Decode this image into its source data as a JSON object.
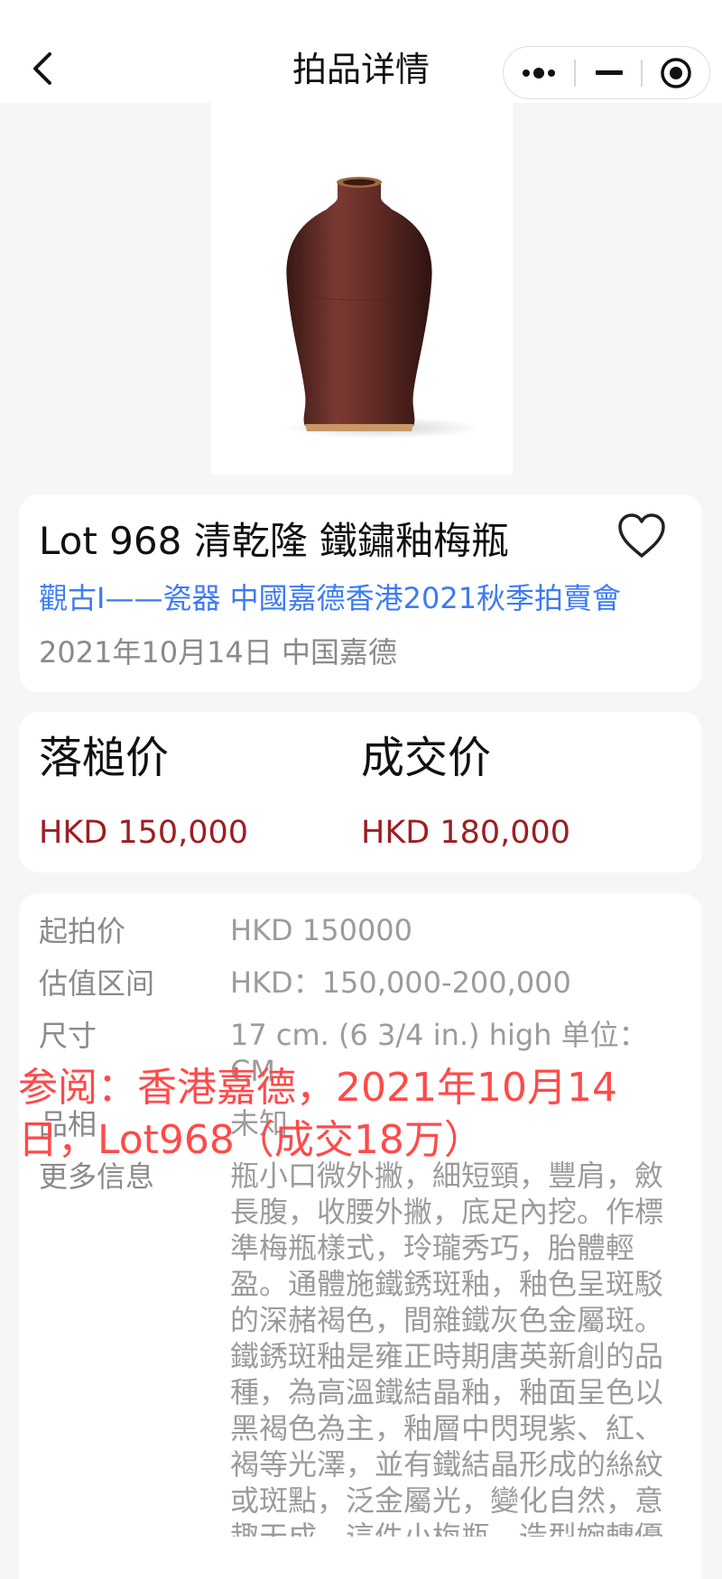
{
  "nav": {
    "title": "拍品详情"
  },
  "lot": {
    "title": "Lot 968 清乾隆 鐵鏽釉梅瓶",
    "sale_link": "觀古I——瓷器 中國嘉德香港2021秋季拍賣會",
    "date_house": "2021年10月14日 中国嘉德"
  },
  "prices": {
    "hammer_label": "落槌价",
    "hammer_value": "HKD 150,000",
    "deal_label": "成交价",
    "deal_value": "HKD 180,000"
  },
  "info": {
    "start_label": "起拍价",
    "start_value": "HKD 150000",
    "estimate_label": "估值区间",
    "estimate_value": "HKD：150,000-200,000",
    "size_label": "尺寸",
    "size_value": "17 cm. (6 3/4 in.) high 单位：CM",
    "condition_label": "品相",
    "condition_value": "未知",
    "more_label": "更多信息",
    "more_value": "瓶小口微外撇，細短頸，豐肩，斂長腹，收腰外撇，底足內挖。作標準梅瓶樣式，玲瓏秀巧，胎體輕盈。通體施鐵銹斑釉，釉色呈斑駁的深赭褐色，間雜鐵灰色金屬斑。鐵銹斑釉是雍正時期唐英新創的品種，為高溫鐵結晶釉，釉面呈色以黑褐色為主，釉層中閃現紫、紅、褐等光澤，並有鐵結晶形成的絲紋或斑點，泛金屬光，變化自然，意趣天成。這件小梅瓶，造型婉轉優"
  },
  "watermark": {
    "text": "参阅：香港嘉德，2021年10月14日，Lot968（成交18万）"
  },
  "colors": {
    "link": "#3d7bf2",
    "price": "#9e1d22",
    "watermark": "#ff4a4a",
    "background": "#f6f6f6"
  },
  "icons": {
    "back": "chevron-left-icon",
    "more": "more-dots-icon",
    "minimize": "minimize-icon",
    "close": "target-circle-icon",
    "favorite": "heart-outline-icon"
  }
}
